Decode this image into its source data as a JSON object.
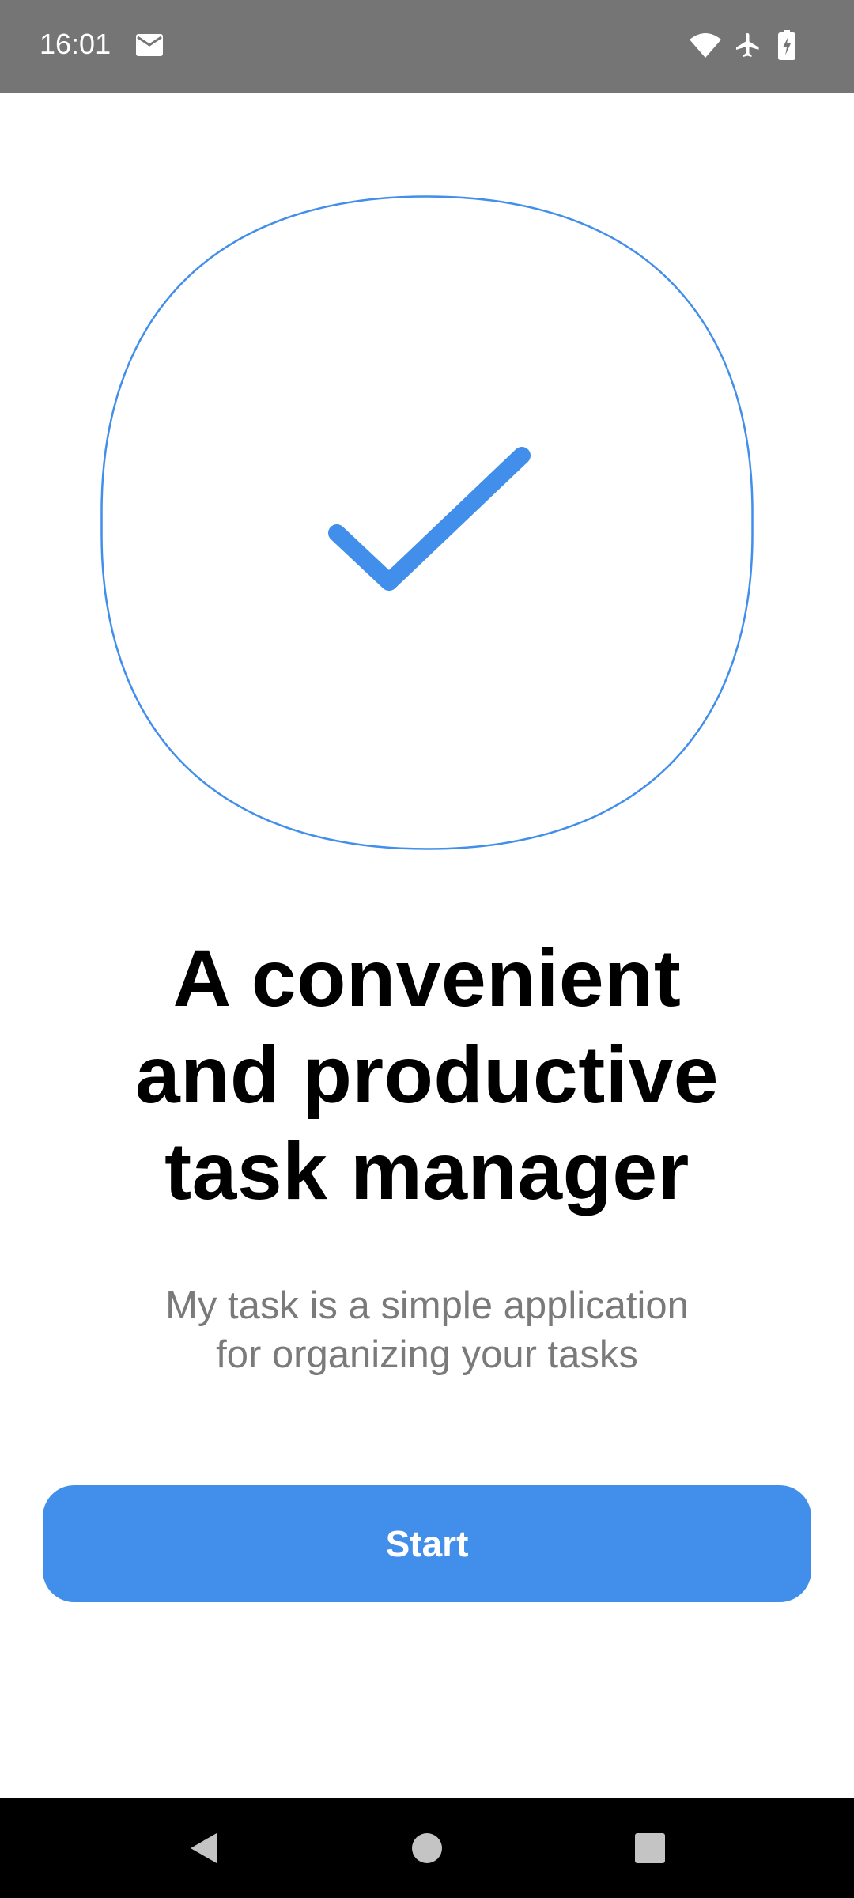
{
  "status_bar": {
    "time": "16:01",
    "background": "#757575",
    "icons": [
      "mail-icon",
      "wifi-icon",
      "airplane-icon",
      "battery-charging-icon"
    ]
  },
  "illustration": {
    "shape_color": "#418eeb",
    "check_color": "#418eeb",
    "icon": "checkmark-icon"
  },
  "onboarding": {
    "headline_lines": [
      "A convenient",
      "and productive",
      "task manager"
    ],
    "subtitle_lines": [
      "My task is a simple application",
      "for organizing your tasks"
    ],
    "start_label": "Start",
    "accent_color": "#418eeb"
  },
  "nav_bar": {
    "buttons": [
      "back-icon",
      "home-icon",
      "recents-icon"
    ]
  }
}
